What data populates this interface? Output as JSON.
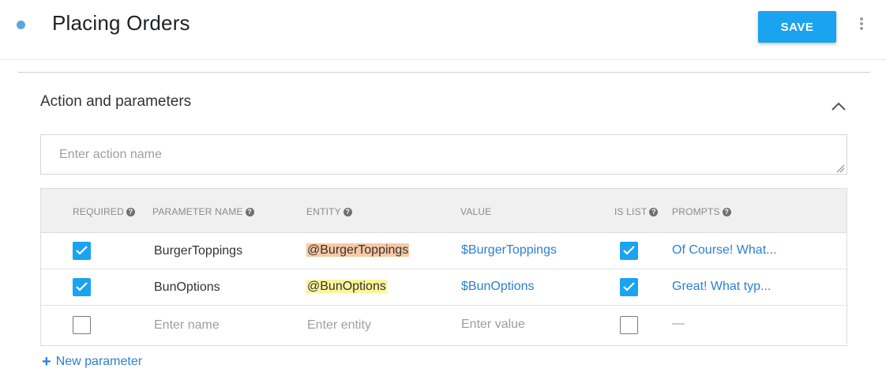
{
  "header": {
    "title": "Placing Orders",
    "save_label": "SAVE"
  },
  "section": {
    "title": "Action and parameters",
    "action_placeholder": "Enter action name"
  },
  "table": {
    "columns": [
      {
        "label": "REQUIRED",
        "help": "?"
      },
      {
        "label": "PARAMETER NAME",
        "help": "?"
      },
      {
        "label": "ENTITY",
        "help": "?"
      },
      {
        "label": "VALUE",
        "help": ""
      },
      {
        "label": "IS LIST",
        "help": "?"
      },
      {
        "label": "PROMPTS",
        "help": "?"
      }
    ],
    "rows": [
      {
        "required": true,
        "name": "BurgerToppings",
        "entity": "@BurgerToppings",
        "value": "$BurgerToppings",
        "is_list": true,
        "prompts": "Of Course! What..."
      },
      {
        "required": true,
        "name": "BunOptions",
        "entity": "@BunOptions",
        "value": "$BunOptions",
        "is_list": true,
        "prompts": "Great! What typ..."
      }
    ],
    "empty_row": {
      "required": false,
      "name_placeholder": "Enter name",
      "entity_placeholder": "Enter entity",
      "value_placeholder": "Enter value",
      "is_list": false,
      "prompts": "—"
    }
  },
  "new_parameter_label": "New parameter",
  "colors": {
    "accent": "#1aa3ef",
    "link": "#2d7fd3",
    "entity_highlight_1": "#f8c9a4",
    "entity_highlight_2": "#fbf59a"
  }
}
